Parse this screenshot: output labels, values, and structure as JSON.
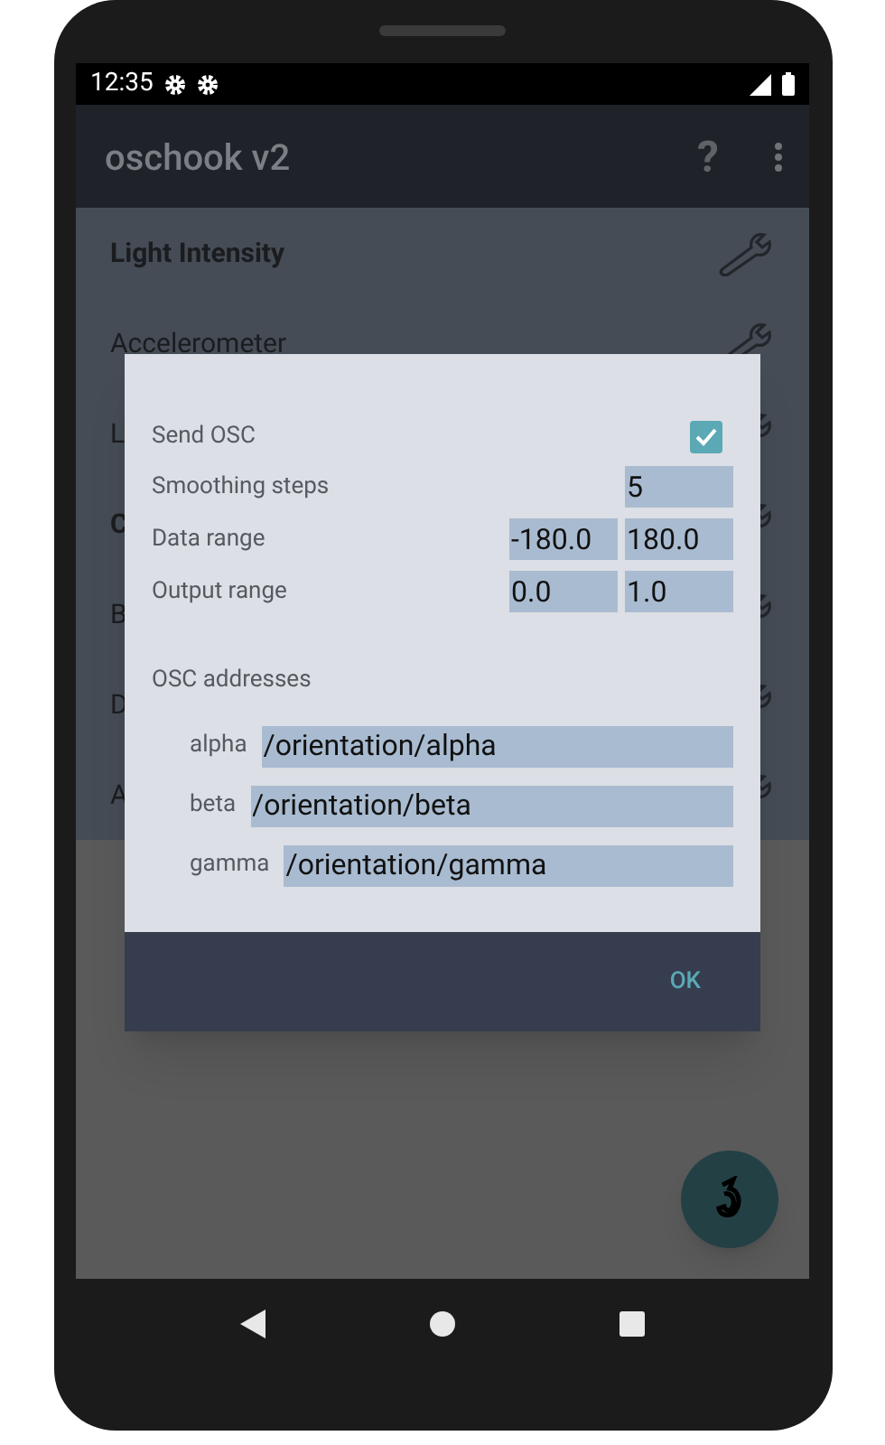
{
  "status_bar": {
    "time": "12:35"
  },
  "app_bar": {
    "title": "oschook v2",
    "help": "?"
  },
  "sensors": [
    {
      "label": "Light Intensity",
      "bold": true
    },
    {
      "label": "Accelerometer",
      "bold": false
    },
    {
      "label": "L",
      "bold": false
    },
    {
      "label": "C",
      "bold": true
    },
    {
      "label": "B",
      "bold": false
    },
    {
      "label": "D",
      "bold": false
    },
    {
      "label": "A",
      "bold": false
    }
  ],
  "dialog": {
    "send_osc": {
      "label": "Send OSC",
      "checked": true
    },
    "rows": [
      {
        "label": "Smoothing steps",
        "values": [
          "5"
        ]
      },
      {
        "label": "Data range",
        "values": [
          "-180.0",
          "180.0"
        ]
      },
      {
        "label": "Output range",
        "values": [
          "0.0",
          "1.0"
        ]
      }
    ],
    "addresses_heading": "OSC addresses",
    "addresses": [
      {
        "label": "alpha",
        "value": "/orientation/alpha"
      },
      {
        "label": "beta",
        "value": "/orientation/beta"
      },
      {
        "label": "gamma",
        "value": "/orientation/gamma"
      }
    ],
    "button": "OK"
  }
}
